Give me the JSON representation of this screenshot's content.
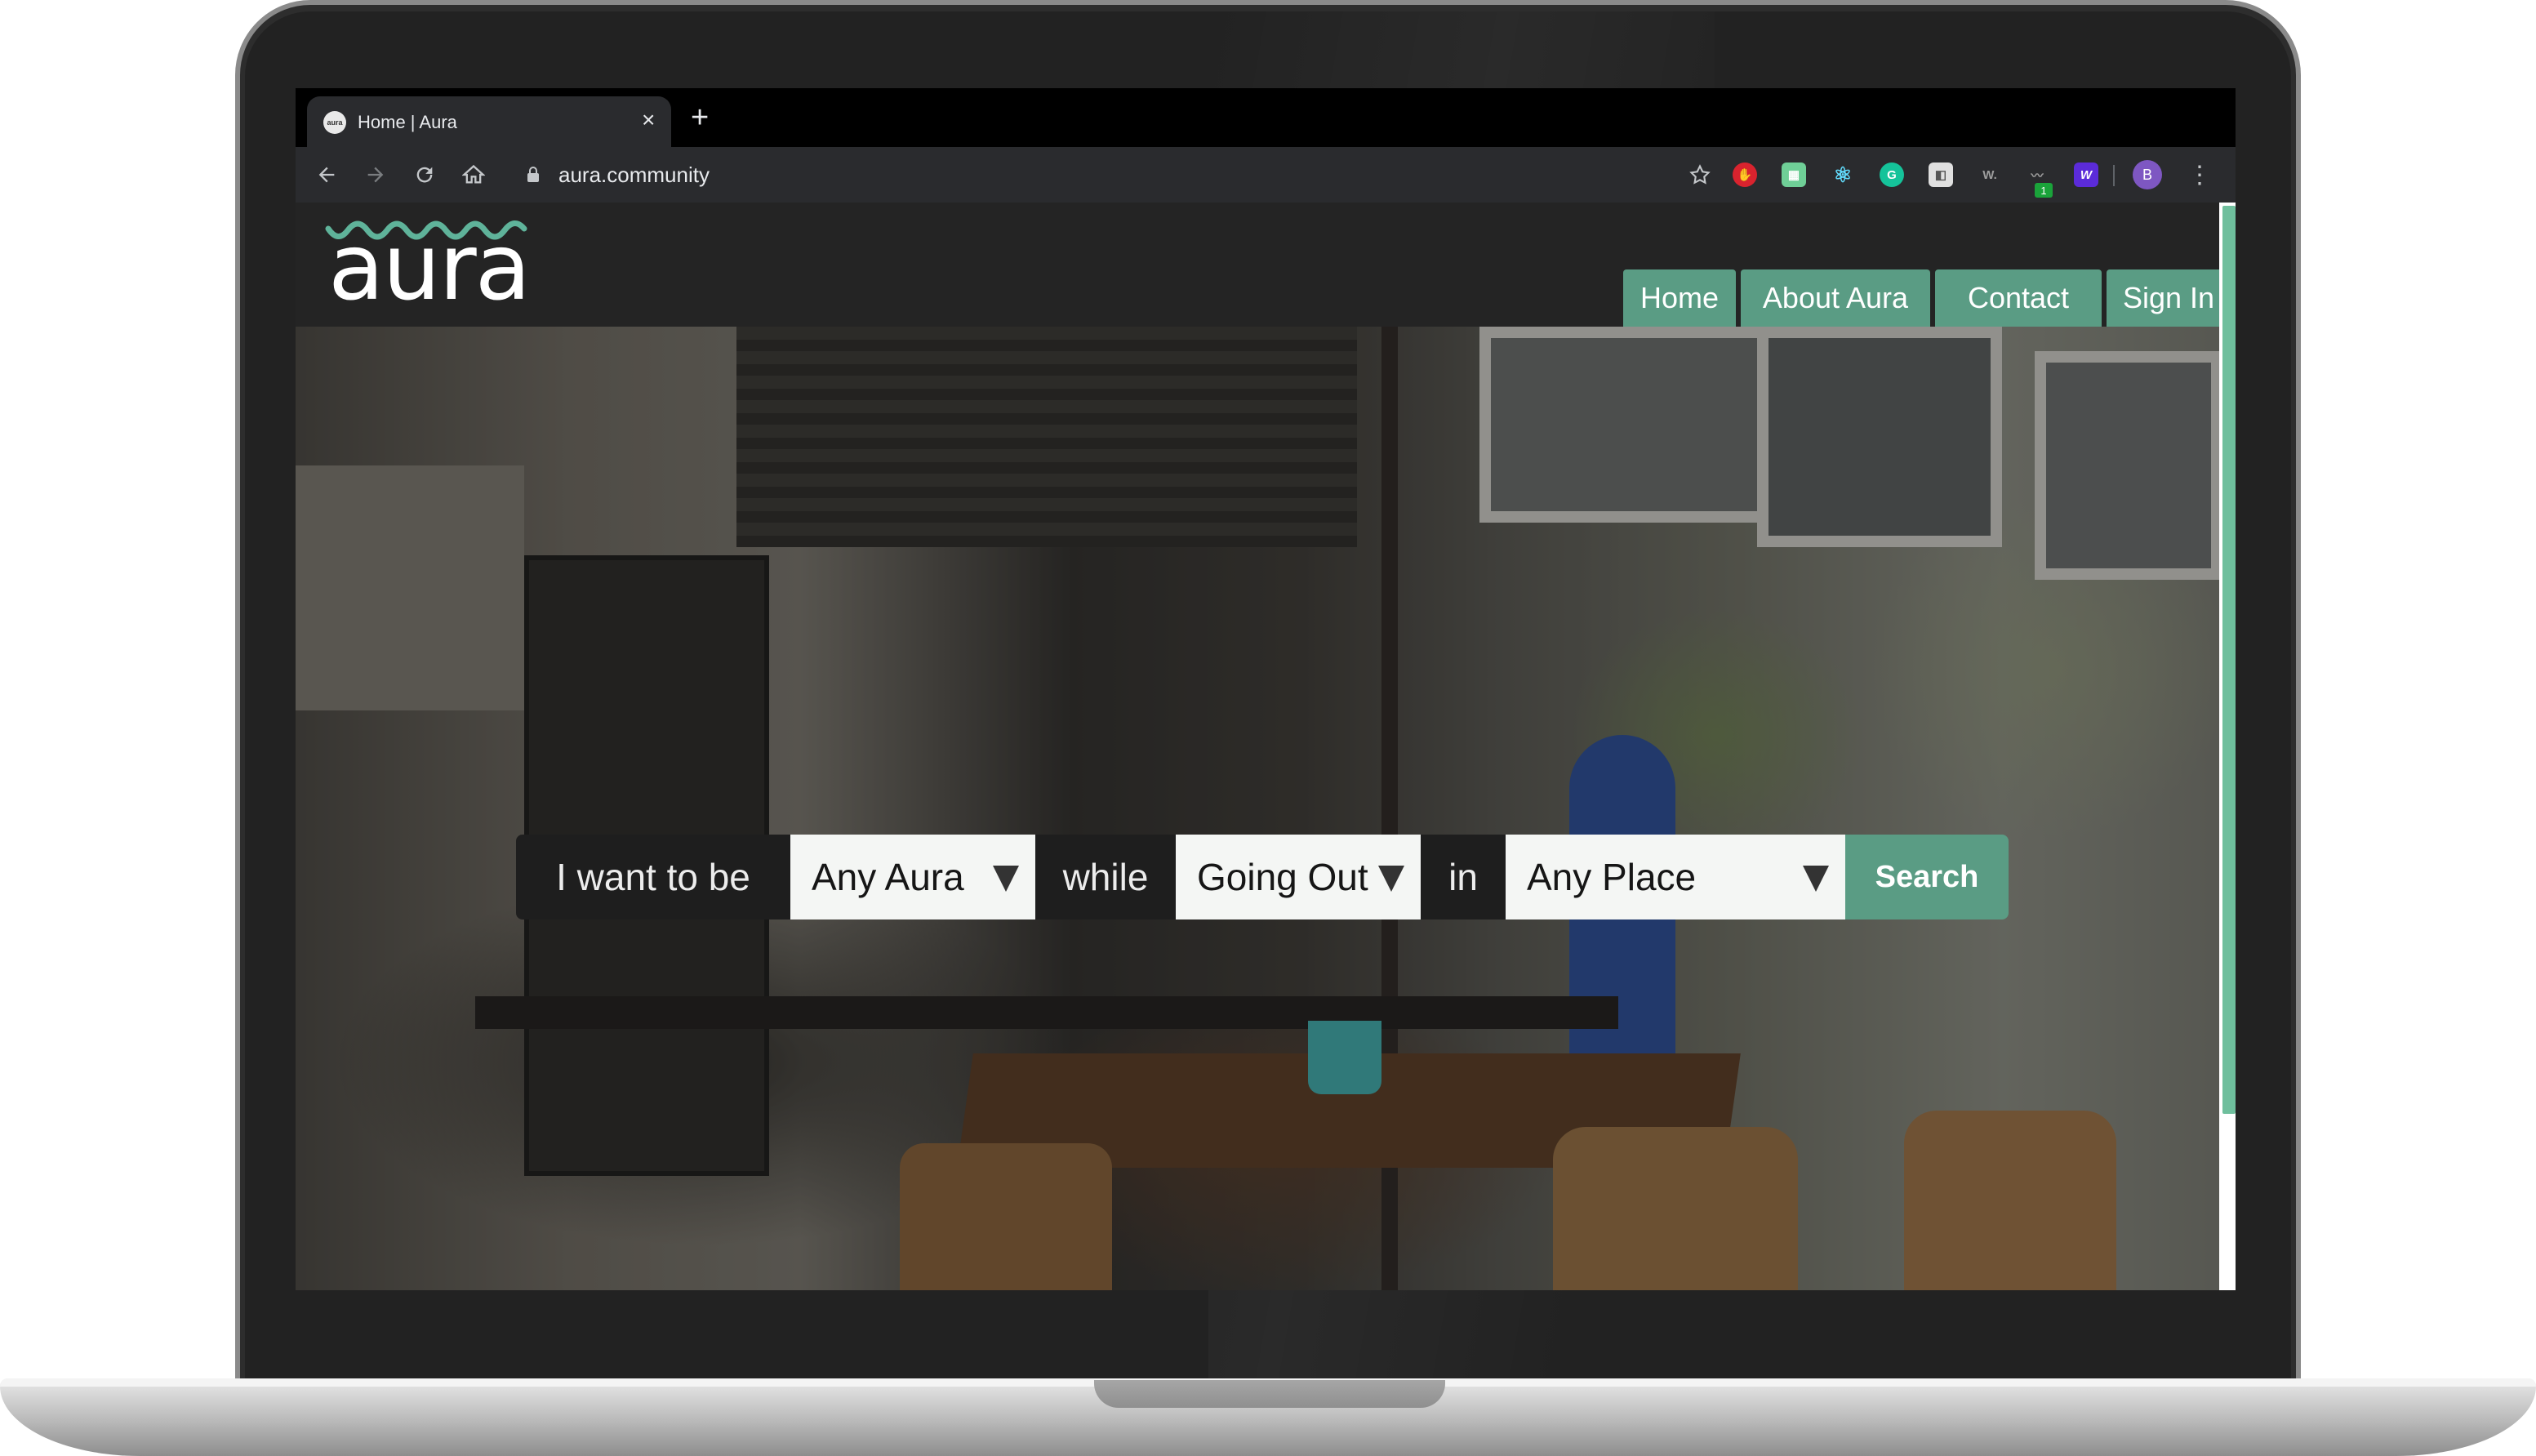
{
  "browser": {
    "tab_title": "Home | Aura",
    "tab_favicon_text": "aura",
    "new_tab_symbol": "+",
    "close_symbol": "×",
    "url": "aura.community",
    "profile_initial": "B",
    "extension_badge": "1",
    "extensions": [
      "adblock-icon",
      "extension-green-icon",
      "react-devtools-icon",
      "grammarly-icon",
      "extension-notes-icon",
      "wappalyzer-icon",
      "pulse-icon",
      "wave-icon"
    ]
  },
  "site": {
    "logo_text": "aura",
    "nav": [
      {
        "label": "Home"
      },
      {
        "label": "About Aura"
      },
      {
        "label": "Contact"
      },
      {
        "label": "Sign In"
      }
    ],
    "search": {
      "prefix": "I want to be",
      "aura_value": "Any Aura",
      "while_label": "while",
      "activity_value": "Going Out",
      "in_label": "in",
      "place_value": "Any Place",
      "button_label": "Search"
    }
  },
  "colors": {
    "accent": "#5a9c84",
    "header_bg": "#242424",
    "tab_bg": "#2a2b2e"
  }
}
